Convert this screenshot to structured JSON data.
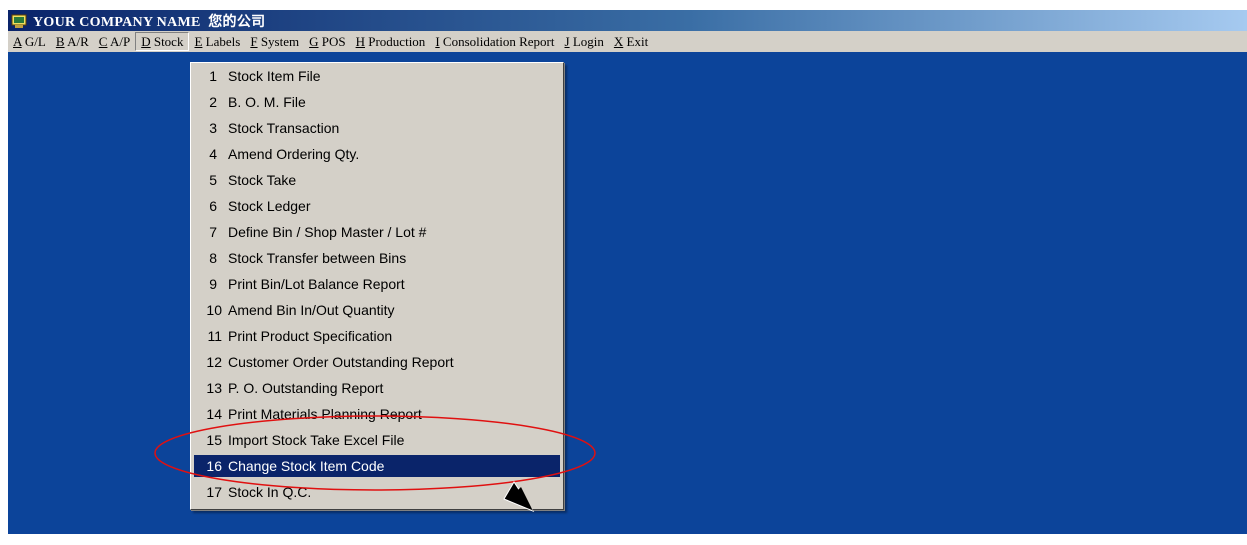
{
  "window": {
    "title": "YOUR COMPANY NAME  您的公司",
    "background_color": "#0c449a"
  },
  "menubar": {
    "items": [
      {
        "key": "A",
        "label": " G/L"
      },
      {
        "key": "B",
        "label": " A/R"
      },
      {
        "key": "C",
        "label": " A/P"
      },
      {
        "key": "D",
        "label": " Stock"
      },
      {
        "key": "E",
        "label": " Labels"
      },
      {
        "key": "F",
        "label": " System"
      },
      {
        "key": "G",
        "label": " POS"
      },
      {
        "key": "H",
        "label": " Production"
      },
      {
        "key": "I",
        "label": " Consolidation Report"
      },
      {
        "key": "J",
        "label": " Login"
      },
      {
        "key": "X",
        "label": " Exit"
      }
    ],
    "open_index": 3
  },
  "stock_menu": {
    "items": [
      {
        "num": "1",
        "label": "Stock Item File"
      },
      {
        "num": "2",
        "label": "B. O. M. File"
      },
      {
        "num": "3",
        "label": "Stock Transaction"
      },
      {
        "num": "4",
        "label": "Amend Ordering Qty."
      },
      {
        "num": "5",
        "label": "Stock Take"
      },
      {
        "num": "6",
        "label": "Stock Ledger"
      },
      {
        "num": "7",
        "label": "Define Bin / Shop Master / Lot #"
      },
      {
        "num": "8",
        "label": "Stock Transfer between Bins"
      },
      {
        "num": "9",
        "label": "Print Bin/Lot Balance Report"
      },
      {
        "num": "10",
        "label": "Amend Bin In/Out Quantity"
      },
      {
        "num": "11",
        "label": "Print Product Specification"
      },
      {
        "num": "12",
        "label": "Customer Order Outstanding Report"
      },
      {
        "num": "13",
        "label": "P. O. Outstanding Report"
      },
      {
        "num": "14",
        "label": "Print Materials Planning Report"
      },
      {
        "num": "15",
        "label": "Import Stock Take Excel File"
      },
      {
        "num": "16",
        "label": "Change Stock Item Code"
      },
      {
        "num": "17",
        "label": "Stock In Q.C."
      }
    ],
    "selected_index": 15,
    "selected_color": "#0a246a"
  },
  "annotation": {
    "color": "#e01010",
    "shape": "ellipse"
  }
}
